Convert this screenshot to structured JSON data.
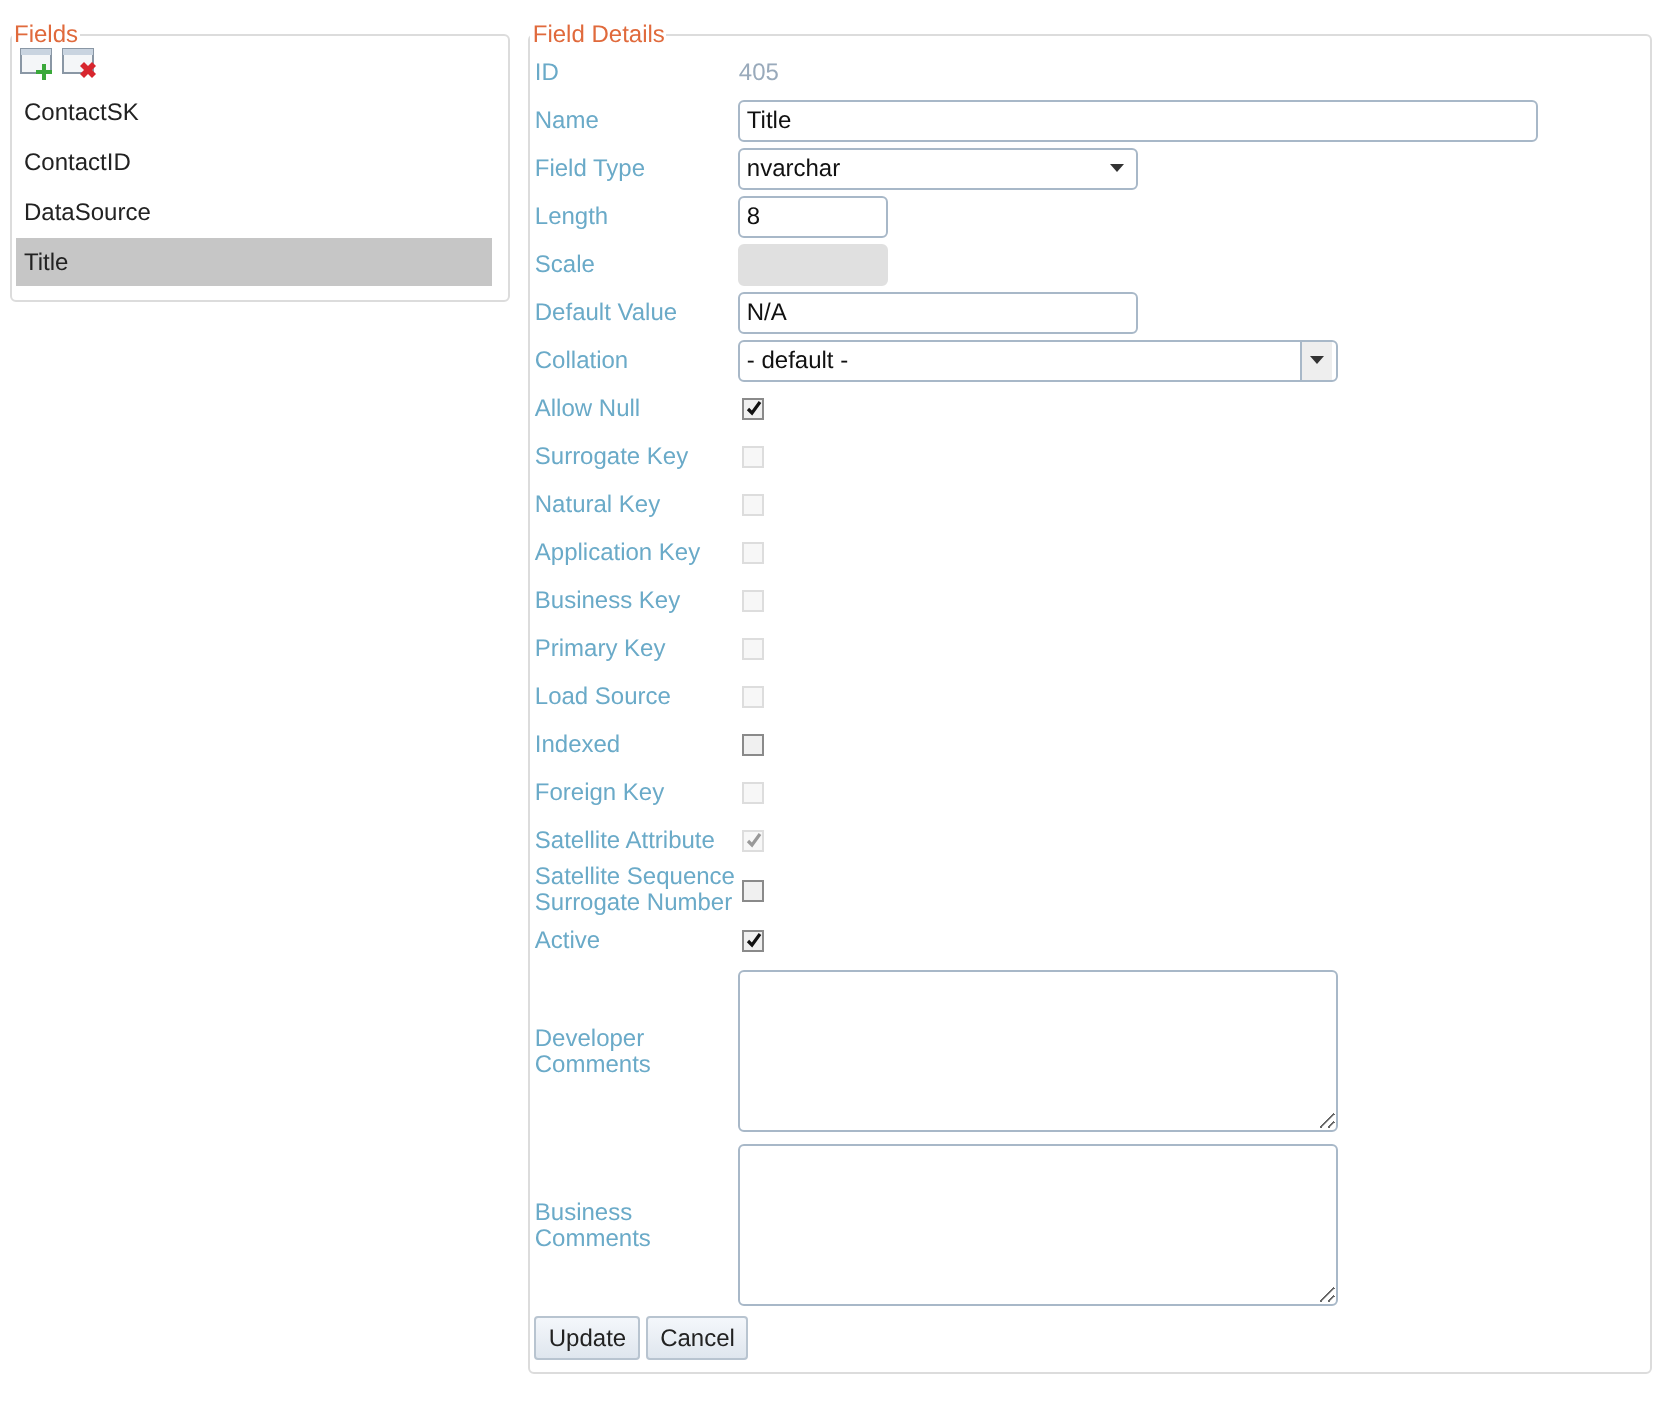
{
  "fields_panel": {
    "legend": "Fields",
    "items": [
      {
        "label": "ContactSK",
        "selected": false
      },
      {
        "label": "ContactID",
        "selected": false
      },
      {
        "label": "DataSource",
        "selected": false
      },
      {
        "label": "Title",
        "selected": true
      }
    ]
  },
  "details": {
    "legend": "Field Details",
    "rows": [
      {
        "kind": "static",
        "label": "ID",
        "value": "405"
      },
      {
        "kind": "text",
        "label": "Name",
        "value": "Title"
      },
      {
        "kind": "select",
        "label": "Field Type",
        "value": "nvarchar"
      },
      {
        "kind": "text",
        "label": "Length",
        "value": "8"
      },
      {
        "kind": "text",
        "label": "Scale",
        "disabled": true
      },
      {
        "kind": "text",
        "label": "Default Value",
        "value": "N/A"
      },
      {
        "kind": "select",
        "label": "Collation",
        "value": "- default -"
      },
      {
        "kind": "checkbox",
        "label": "Allow Null",
        "checked": true,
        "disabled": false
      },
      {
        "kind": "checkbox",
        "label": "Surrogate Key",
        "checked": false,
        "disabled": true
      },
      {
        "kind": "checkbox",
        "label": "Natural Key",
        "checked": false,
        "disabled": true
      },
      {
        "kind": "checkbox",
        "label": "Application Key",
        "checked": false,
        "disabled": true
      },
      {
        "kind": "checkbox",
        "label": "Business Key",
        "checked": false,
        "disabled": true
      },
      {
        "kind": "checkbox",
        "label": "Primary Key",
        "checked": false,
        "disabled": true
      },
      {
        "kind": "checkbox",
        "label": "Load Source",
        "checked": false,
        "disabled": true
      },
      {
        "kind": "checkbox",
        "label": "Indexed",
        "checked": false,
        "disabled": false
      },
      {
        "kind": "checkbox",
        "label": "Foreign Key",
        "checked": false,
        "disabled": true
      },
      {
        "kind": "checkbox",
        "label": "Satellite Attribute",
        "checked": true,
        "disabled": true
      },
      {
        "kind": "checkbox",
        "label": "Satellite Sequence Surrogate Number",
        "checked": false,
        "disabled": false
      },
      {
        "kind": "checkbox",
        "label": "Active",
        "checked": true,
        "disabled": false
      },
      {
        "kind": "textarea",
        "label": "Developer Comments"
      },
      {
        "kind": "textarea",
        "label": "Business Comments"
      }
    ],
    "buttons": [
      "Update",
      "Cancel"
    ]
  }
}
